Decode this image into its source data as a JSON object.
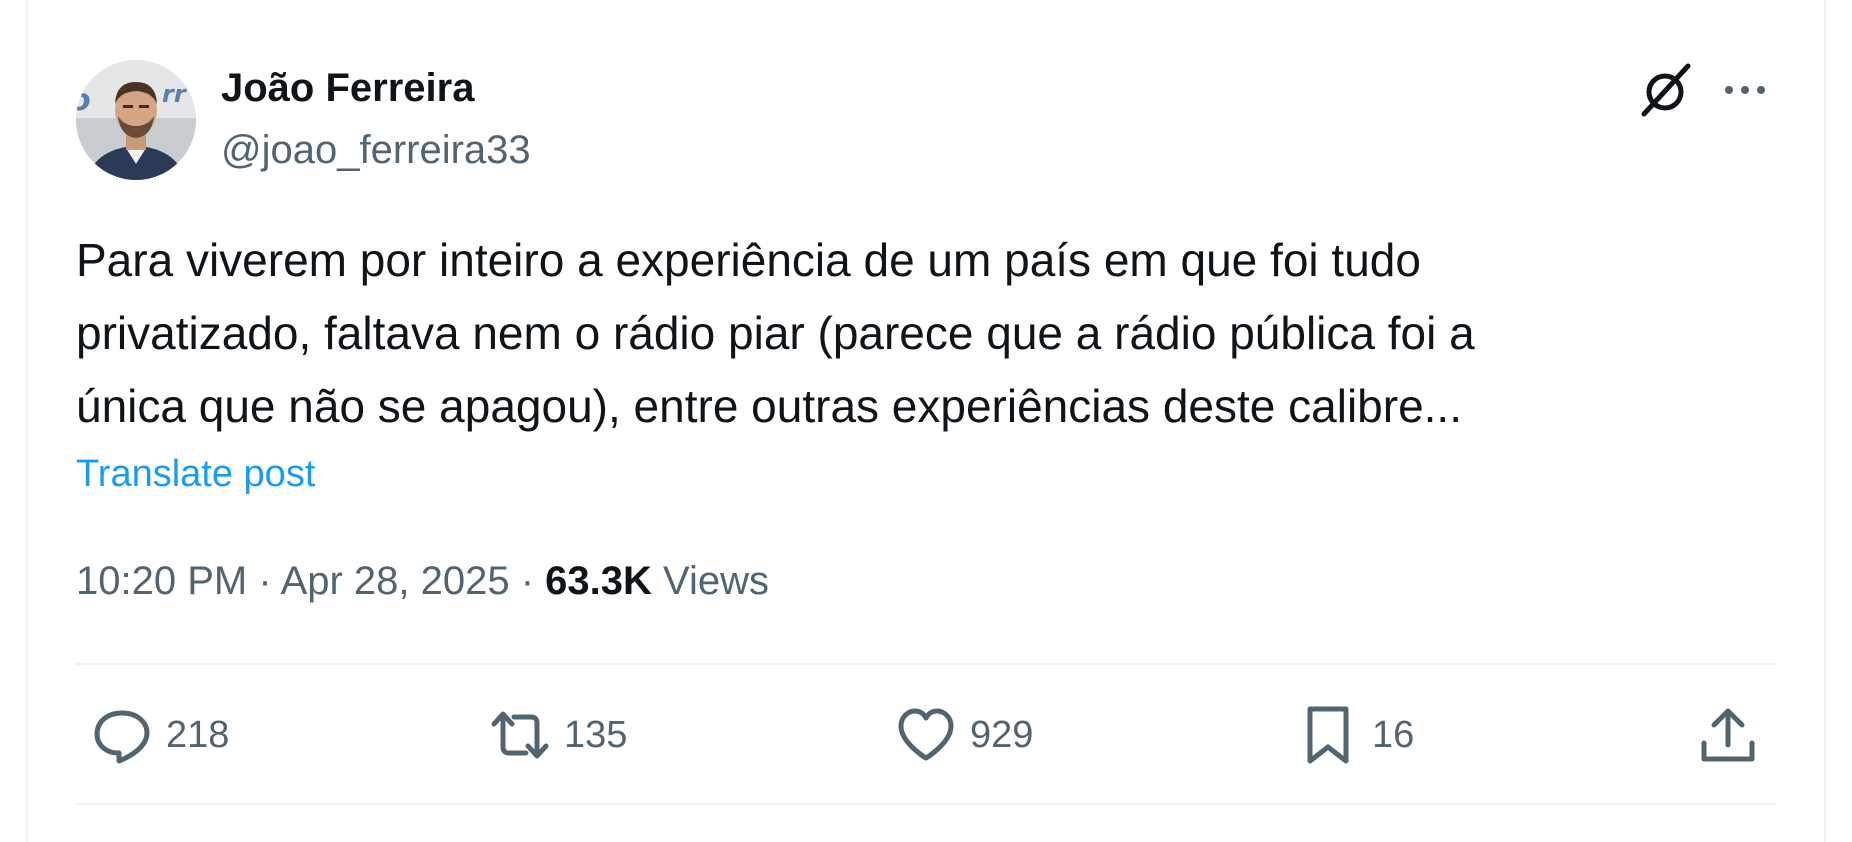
{
  "author": {
    "display_name": "João Ferreira",
    "handle": "@joao_ferreira33"
  },
  "post": {
    "text": "Para viverem por inteiro a experiência de um país em que foi tudo\nprivatizado, faltava nem o rádio piar (parece que a rádio pública foi a\núnica que não se apagou), entre outras experiências deste calibre...",
    "translate_label": "Translate post",
    "time": "10:20 PM",
    "separator": " · ",
    "date": "Apr 28, 2025",
    "views_count": "63.3K",
    "views_label": "Views"
  },
  "actions": {
    "replies": "218",
    "reposts": "135",
    "likes": "929",
    "bookmarks": "16"
  },
  "icons": {
    "top_right": [
      "grok-icon",
      "more-icon"
    ],
    "actions": [
      "reply-icon",
      "repost-icon",
      "like-icon",
      "bookmark-icon",
      "share-icon"
    ]
  },
  "colors": {
    "text_primary": "#0f1419",
    "text_secondary": "#536471",
    "link": "#1d9bf0",
    "divider": "#eff3f4"
  }
}
